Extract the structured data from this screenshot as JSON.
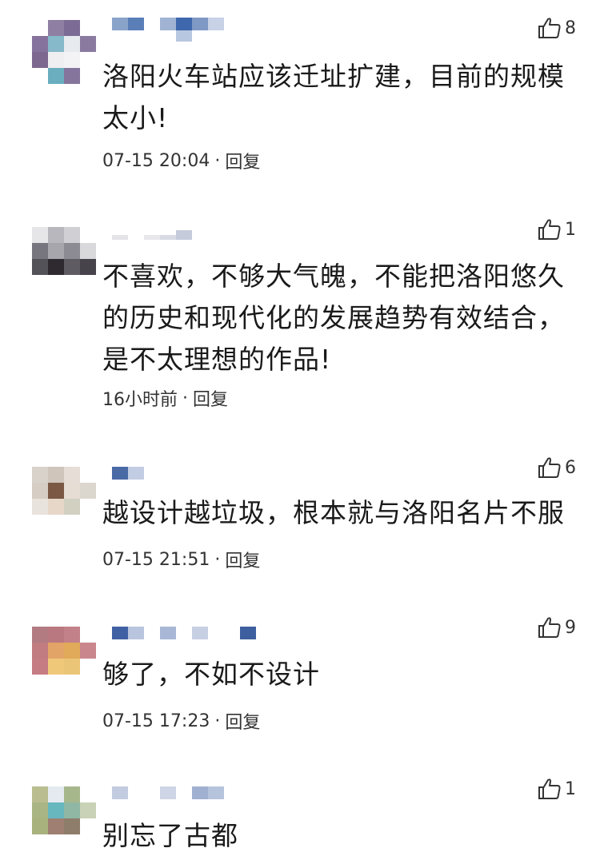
{
  "comments": [
    {
      "likes": "8",
      "lines": [
        "洛阳火车站应该迁址扩建，目前的规模",
        "太小!"
      ],
      "time": "07-15 20:04",
      "reply": "回复"
    },
    {
      "likes": "1",
      "lines": [
        "不喜欢，不够大气魄，不能把洛阳悠久",
        "的历史和现代化的发展趋势有效结合，",
        "是不太理想的作品!"
      ],
      "time": "16小时前",
      "reply": "回复"
    },
    {
      "likes": "6",
      "lines": [
        "越设计越垃圾，根本就与洛阳名片不服"
      ],
      "time": "07-15 21:51",
      "reply": "回复"
    },
    {
      "likes": "9",
      "lines": [
        "够了，不如不设计"
      ],
      "time": "07-15 17:23",
      "reply": "回复"
    },
    {
      "likes": "1",
      "lines": [
        "别忘了古都"
      ],
      "time": "",
      "reply": ""
    }
  ],
  "separator": "·",
  "icons": {
    "like": "thumbs-up-icon"
  }
}
